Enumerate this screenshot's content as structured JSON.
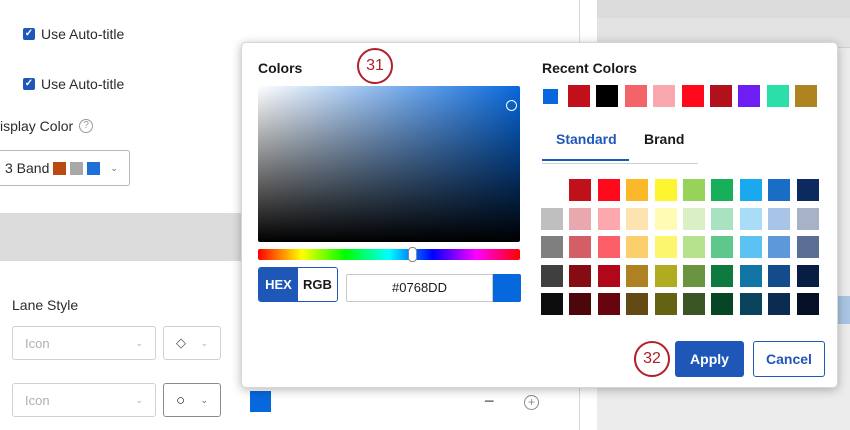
{
  "background": {
    "auto_title_1": "Use Auto-title",
    "auto_title_2": "Use Auto-title",
    "display_color_label": "isplay Color",
    "help_icon": "?",
    "band_select": {
      "label": "3 Band",
      "swatches": [
        "#b94a11",
        "#a8a8a8",
        "#1f6fd6"
      ]
    },
    "lane_style_label": "Lane Style",
    "rows": [
      {
        "select_value": "Icon",
        "shape": "◇"
      },
      {
        "select_value": "Icon",
        "shape": "○"
      }
    ],
    "minus": "−",
    "plus": "+"
  },
  "picker": {
    "colors_title": "Colors",
    "recent_title": "Recent Colors",
    "callout_top": "31",
    "callout_apply": "32",
    "selected_color": "#0768DD",
    "mode": {
      "hex": "HEX",
      "rgb": "RGB",
      "active": "HEX"
    },
    "recent_colors": [
      "#0768dd",
      "#c0111b",
      "#000000",
      "#f4636a",
      "#f9a8ae",
      "#ff0a1c",
      "#b1111c",
      "#6c1ef5",
      "#2bdfaa",
      "#ad841f"
    ],
    "tabs": {
      "standard": "Standard",
      "brand": "Brand",
      "active": "Standard"
    },
    "standard_colors": [
      [
        "#ffffff",
        "#c0111b",
        "#ff0a1c",
        "#fbb929",
        "#fcf530",
        "#97d35a",
        "#17af5a",
        "#1aa9ee",
        "#1a6dc5",
        "#0c2960"
      ],
      [
        "#bfbfbf",
        "#e8a8ad",
        "#fca8ae",
        "#fde3b0",
        "#fdfbb4",
        "#d9efc4",
        "#a8e2c0",
        "#a8dcf7",
        "#a8c5e7",
        "#a7b2c7"
      ],
      [
        "#7f7f7f",
        "#d45e66",
        "#fd5f69",
        "#fccf6d",
        "#fcf56e",
        "#b6e28d",
        "#5ec88c",
        "#5cc2f2",
        "#5d99d8",
        "#5b6e94"
      ],
      [
        "#3f3f3f",
        "#860c13",
        "#b2071a",
        "#ae8122",
        "#b0ac22",
        "#6a9440",
        "#0f7a40",
        "#1276a5",
        "#144c8b",
        "#081d44"
      ],
      [
        "#0d0d0d",
        "#4c070b",
        "#660410",
        "#634a13",
        "#656214",
        "#3c5524",
        "#084524",
        "#0a435e",
        "#0b2b50",
        "#051027"
      ]
    ],
    "apply_label": "Apply",
    "cancel_label": "Cancel"
  }
}
